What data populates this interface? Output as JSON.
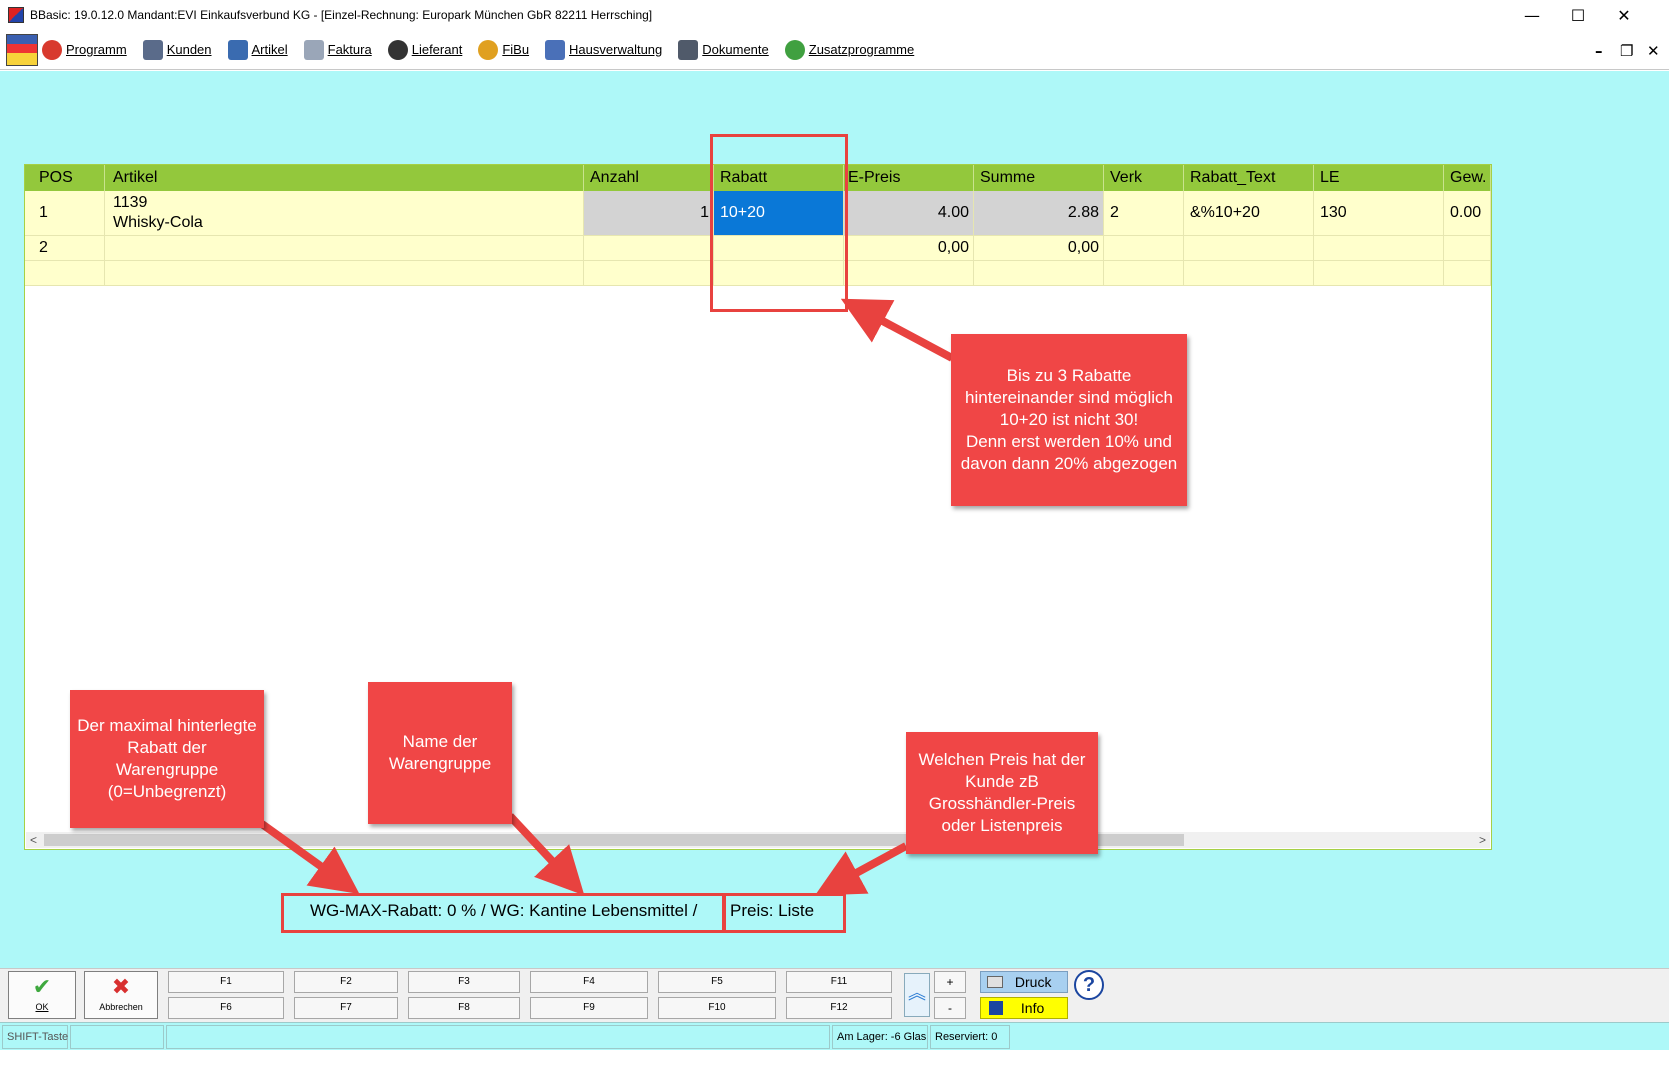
{
  "window": {
    "title": "BBasic: 19.0.12.0 Mandant:EVI Einkaufsverbund KG  - [Einzel-Rechnung: Europark München GbR 82211 Herrsching]",
    "minimize_glyph": "—",
    "maximize_glyph": "☐",
    "close_glyph": "✕"
  },
  "menu": {
    "items": [
      {
        "label": "Programm",
        "icon": "programm-icon",
        "color": "#d83a2e"
      },
      {
        "label": "Kunden",
        "icon": "kunden-icon",
        "color": "#5a6b8a"
      },
      {
        "label": "Artikel",
        "icon": "artikel-icon",
        "color": "#3a6bb0"
      },
      {
        "label": "Faktura",
        "icon": "faktura-icon",
        "color": "#9aa6b8"
      },
      {
        "label": "Lieferant",
        "icon": "lieferant-icon",
        "color": "#333333"
      },
      {
        "label": "FiBu",
        "icon": "euro-icon",
        "color": "#e0a020"
      },
      {
        "label": "Hausverwaltung",
        "icon": "house-icon",
        "color": "#4a70b8"
      },
      {
        "label": "Dokumente",
        "icon": "document-icon",
        "color": "#505a6a"
      },
      {
        "label": "Zusatzprogramme",
        "icon": "zusatz-icon",
        "color": "#40a040"
      }
    ],
    "mdi_minimize": "–",
    "mdi_restore": "❐",
    "mdi_close": "✕"
  },
  "grid": {
    "columns": [
      "POS",
      "Artikel",
      "Anzahl",
      "Rabatt",
      "E-Preis",
      "Summe",
      "Verk",
      "Rabatt_Text",
      "LE",
      "Gew."
    ],
    "rows": [
      {
        "pos": "1",
        "artikel_nr": "1139",
        "artikel_name": "Whisky-Cola",
        "anzahl": "1",
        "rabatt": "10+20",
        "epreis": "4.00",
        "summe": "2.88",
        "verk": "2",
        "rabatt_text": "&%10+20",
        "le": "130",
        "gew": "0.00"
      },
      {
        "pos": "2",
        "artikel_nr": "",
        "artikel_name": "",
        "anzahl": "",
        "rabatt": "",
        "epreis": "0,00",
        "summe": "0,00",
        "verk": "",
        "rabatt_text": "",
        "le": "",
        "gew": ""
      }
    ],
    "scroll_left": "<",
    "scroll_right": ">"
  },
  "info": {
    "wg_line": "WG-MAX-Rabatt: 0 %  / WG: Kantine Lebensmittel /",
    "preis": "Preis: Liste"
  },
  "callouts": {
    "rabatt": "Bis zu 3 Rabatte hintereinander sind möglich\n10+20 ist nicht 30!\nDenn erst werden 10% und davon dann 20% abgezogen",
    "max_rabatt": "Der maximal hinterlegte Rabatt der Warengruppe (0=Unbegrenzt)",
    "warengruppe": "Name der Warengruppe",
    "preis": "Welchen Preis hat der Kunde zB Grosshändler-Preis oder Listenpreis"
  },
  "toolbar": {
    "ok_label": "OK",
    "ok_icon": "✔",
    "cancel_label": "Abbrechen",
    "cancel_icon": "✖",
    "fkeys_top": [
      "F1",
      "F2",
      "F3",
      "F4",
      "F5",
      "F11"
    ],
    "fkeys_bottom": [
      "F6",
      "F7",
      "F8",
      "F9",
      "F10",
      "F12"
    ],
    "plus": "+",
    "minus": "-",
    "scroll_up": "︽",
    "druck_label": "Druck",
    "info_label": "Info",
    "help": "?"
  },
  "status": {
    "shift": "SHIFT-Taste",
    "lager": "Am Lager: -6 Glas",
    "reserviert": "Reserviert: 0"
  },
  "colors": {
    "workspace": "#aef8f8",
    "grid_header": "#93c83c",
    "row_bg": "#ffffcc",
    "selected": "#0a78d7",
    "callout": "#f04646"
  }
}
